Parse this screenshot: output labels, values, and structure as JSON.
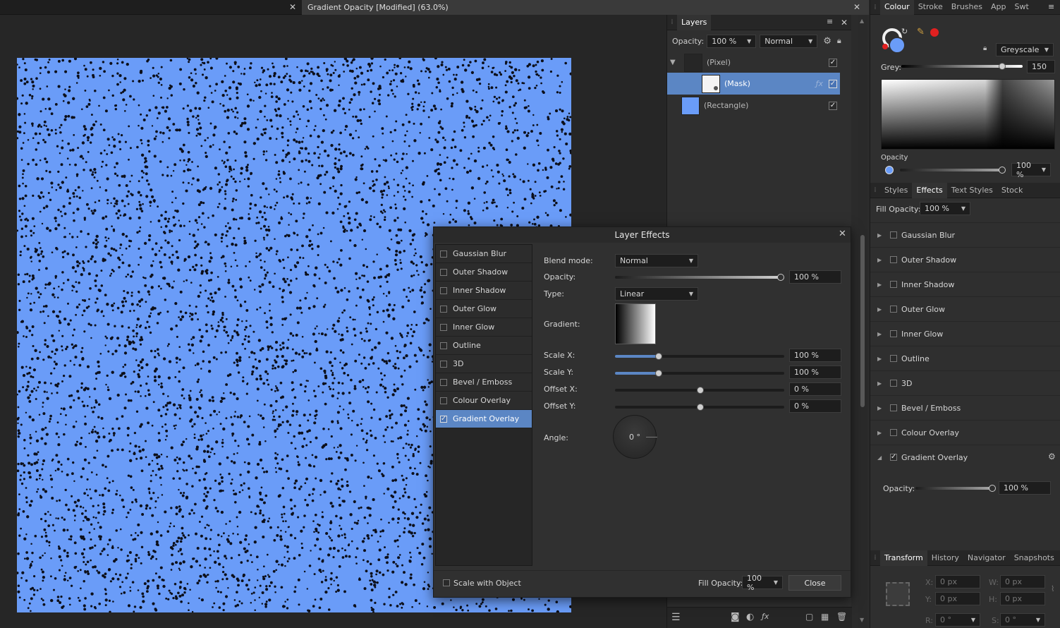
{
  "document": {
    "tab_title": "Gradient Opacity [Modified] (63.0%)"
  },
  "layers": {
    "tab": "Layers",
    "opacity_label": "Opacity:",
    "opacity_value": "100 %",
    "blend_mode": "Normal",
    "items": [
      {
        "name": "(Pixel)"
      },
      {
        "name": "(Mask)"
      },
      {
        "name": "(Rectangle)"
      }
    ]
  },
  "colour_panel": {
    "tabs": [
      "Colour",
      "Stroke",
      "Brushes",
      "App",
      "Swt"
    ],
    "mode": "Greyscale",
    "grey_label": "Grey:",
    "grey_value": "150",
    "opacity_label": "Opacity",
    "opacity_value": "100 %"
  },
  "effects_panel": {
    "tabs": [
      "Styles",
      "Effects",
      "Text Styles",
      "Stock"
    ],
    "fill_opacity_label": "Fill Opacity:",
    "fill_opacity_value": "100 %",
    "effects": [
      "Gaussian Blur",
      "Outer Shadow",
      "Inner Shadow",
      "Outer Glow",
      "Inner Glow",
      "Outline",
      "3D",
      "Bevel / Emboss",
      "Colour Overlay",
      "Gradient Overlay"
    ],
    "expanded_opacity_label": "Opacity:",
    "expanded_opacity_value": "100 %"
  },
  "transform_panel": {
    "tabs": [
      "Transform",
      "History",
      "Navigator",
      "Snapshots"
    ],
    "x_label": "X:",
    "x_value": "0 px",
    "w_label": "W:",
    "w_value": "0 px",
    "y_label": "Y:",
    "y_value": "0 px",
    "h_label": "H:",
    "h_value": "0 px",
    "r_label": "R:",
    "r_value": "0 °",
    "s_label": "S:",
    "s_value": "0 °"
  },
  "dialog": {
    "title": "Layer Effects",
    "effects": [
      "Gaussian Blur",
      "Outer Shadow",
      "Inner Shadow",
      "Outer Glow",
      "Inner Glow",
      "Outline",
      "3D",
      "Bevel / Emboss",
      "Colour Overlay",
      "Gradient Overlay"
    ],
    "selected_effect": "Gradient Overlay",
    "blend_mode_label": "Blend mode:",
    "blend_mode": "Normal",
    "opacity_label": "Opacity:",
    "opacity_value": "100 %",
    "opacity_fraction": 1.0,
    "type_label": "Type:",
    "type_value": "Linear",
    "gradient_label": "Gradient:",
    "scale_x_label": "Scale X:",
    "scale_x_value": "100 %",
    "scale_y_label": "Scale Y:",
    "scale_y_value": "100 %",
    "offset_x_label": "Offset X:",
    "offset_x_value": "0 %",
    "offset_y_label": "Offset Y:",
    "offset_y_value": "0 %",
    "angle_label": "Angle:",
    "angle_value": "0 °",
    "scale_with_object_label": "Scale with Object",
    "fill_opacity_label": "Fill Opacity:",
    "fill_opacity_value": "100 %",
    "close_label": "Close"
  },
  "colors": {
    "canvas_fill": "#6a9cf8",
    "selection": "#5b86c4",
    "accent_red": "#e02020"
  }
}
